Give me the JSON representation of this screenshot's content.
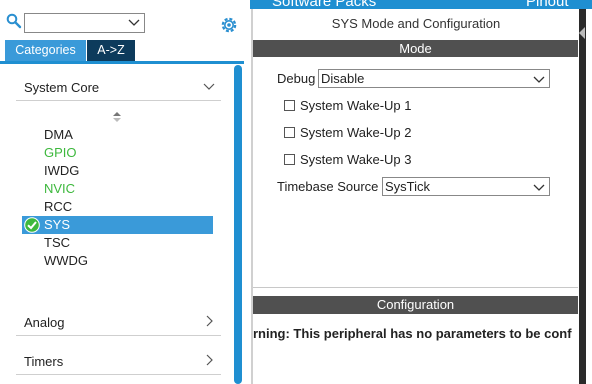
{
  "top_strip": {
    "left_tab": "Software Packs",
    "right_tab": "Pinout"
  },
  "search": {
    "value": "",
    "placeholder": ""
  },
  "tabs": {
    "categories": "Categories",
    "az": "A->Z"
  },
  "categories": [
    {
      "label": "System Core",
      "expanded": true
    },
    {
      "label": "Analog",
      "expanded": false
    },
    {
      "label": "Timers",
      "expanded": false
    }
  ],
  "system_core_items": [
    {
      "label": "DMA",
      "state": "normal"
    },
    {
      "label": "GPIO",
      "state": "green"
    },
    {
      "label": "IWDG",
      "state": "normal"
    },
    {
      "label": "NVIC",
      "state": "green"
    },
    {
      "label": "RCC",
      "state": "normal"
    },
    {
      "label": "SYS",
      "state": "selected"
    },
    {
      "label": "TSC",
      "state": "normal"
    },
    {
      "label": "WWDG",
      "state": "normal"
    }
  ],
  "right": {
    "title": "SYS Mode and Configuration",
    "mode_header": "Mode",
    "debug_label": "Debug",
    "debug_value": "Disable",
    "wakeups": [
      "System Wake-Up 1",
      "System Wake-Up 2",
      "System Wake-Up 3"
    ],
    "timebase_label": "Timebase Source",
    "timebase_value": "SysTick",
    "config_header": "Configuration",
    "warning": "rning: This peripheral has no parameters to be conf"
  },
  "colors": {
    "accent": "#1f8fd1",
    "selected_bg": "#3a9ad9",
    "tab_dark": "#0d3b5c",
    "header_bar": "#505050",
    "green_item": "#3db83d"
  },
  "icons": [
    "search-icon",
    "gear-icon",
    "chevron-down-icon",
    "chevron-right-icon",
    "sort-icon",
    "check-circle-icon"
  ]
}
